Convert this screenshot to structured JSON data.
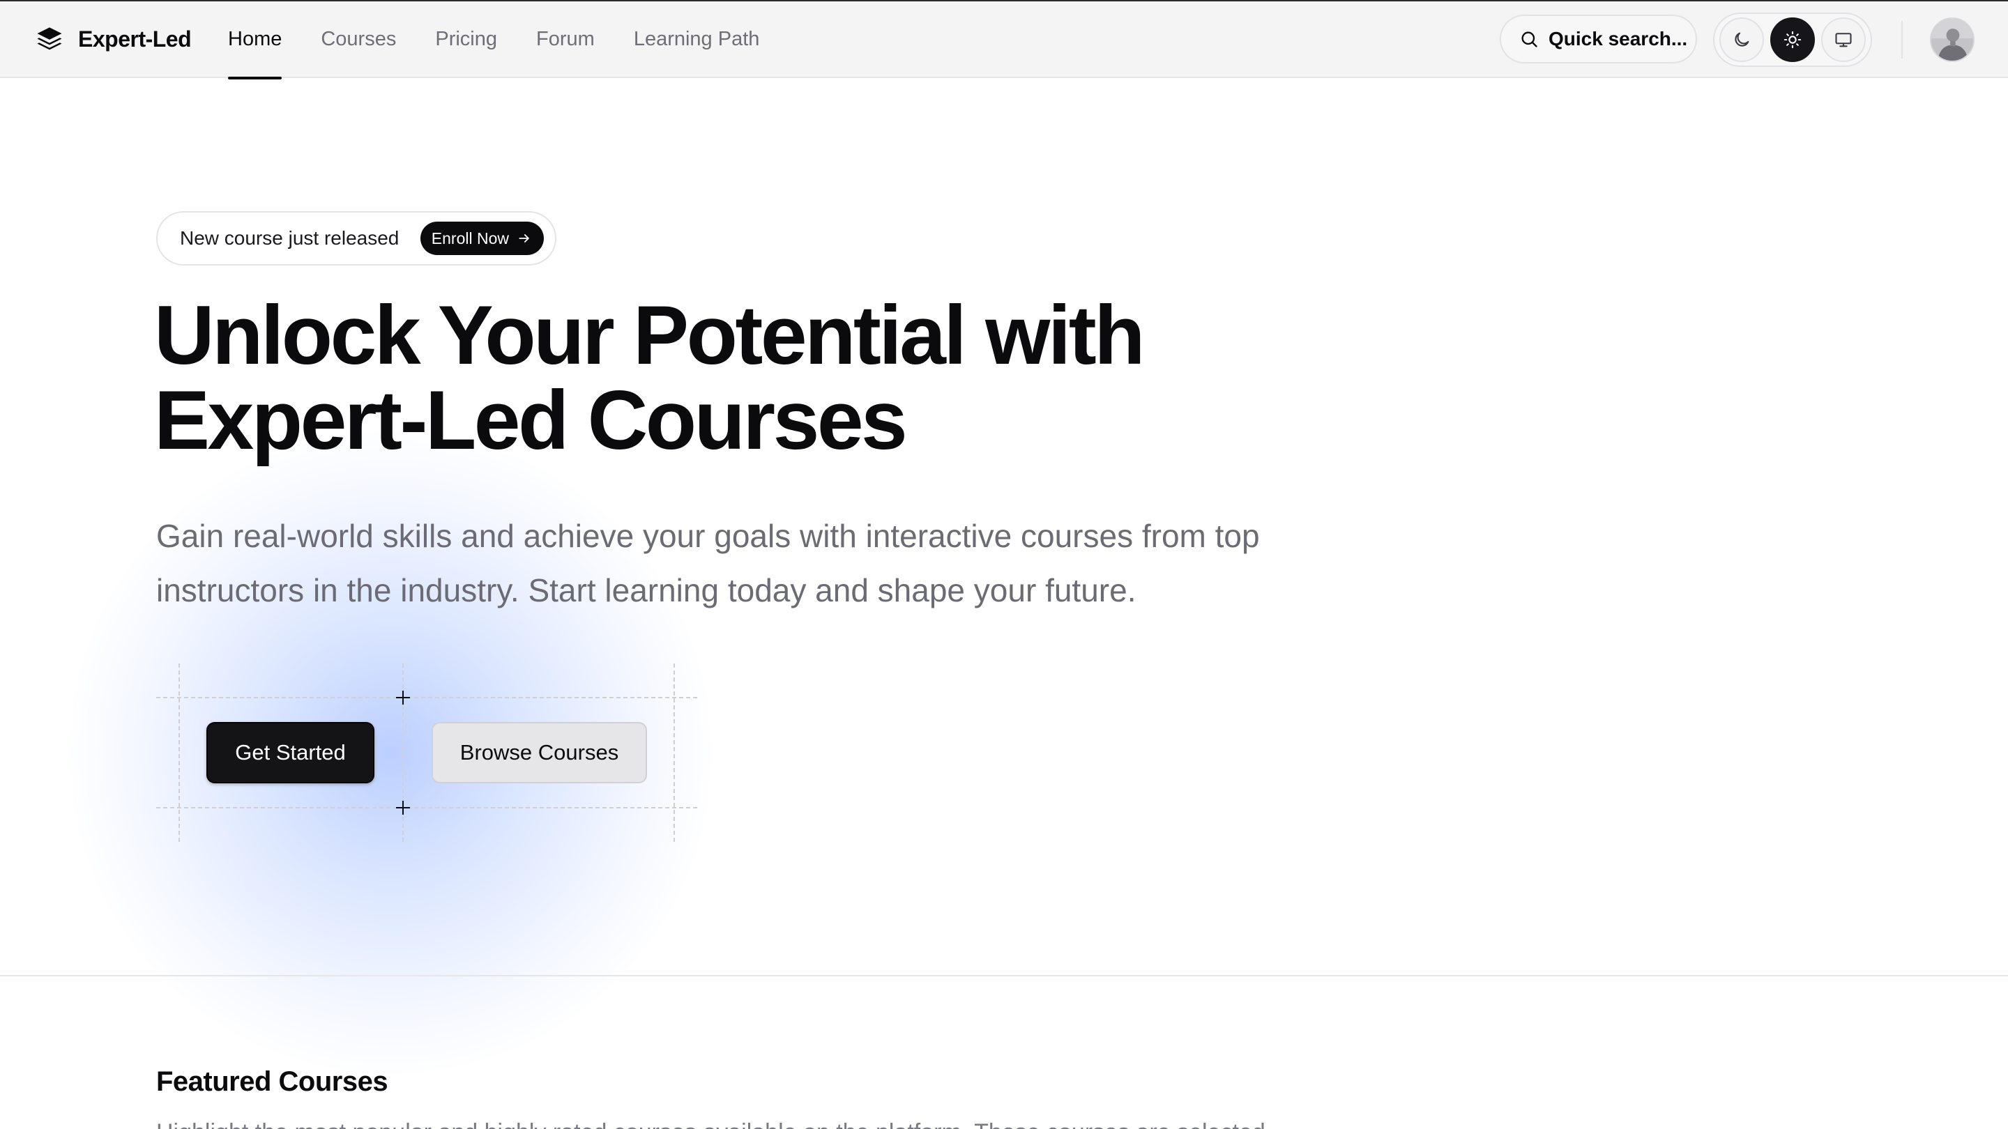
{
  "brand": {
    "name": "Expert-Led",
    "icon": "layers-icon"
  },
  "nav": {
    "items": [
      {
        "label": "Home",
        "active": true
      },
      {
        "label": "Courses",
        "active": false
      },
      {
        "label": "Pricing",
        "active": false
      },
      {
        "label": "Forum",
        "active": false
      },
      {
        "label": "Learning Path",
        "active": false
      }
    ]
  },
  "search": {
    "label": "Quick search...",
    "icon": "search-icon"
  },
  "theme": {
    "options": [
      {
        "icon": "moon-icon",
        "selected": false
      },
      {
        "icon": "sun-icon",
        "selected": true
      },
      {
        "icon": "monitor-icon",
        "selected": false
      }
    ]
  },
  "user": {
    "avatar": "user-avatar"
  },
  "hero": {
    "announcement": "New course just released",
    "announcement_cta": "Enroll Now",
    "title_line1": "Unlock Your Potential with",
    "title_line2": "Expert-Led Courses",
    "subtitle_line1": "Gain real-world skills and achieve your goals with interactive courses from top",
    "subtitle_line2": "instructors in the industry. Start learning today and shape your future.",
    "primary_cta": "Get Started",
    "secondary_cta": "Browse Courses"
  },
  "featured": {
    "title": "Featured Courses",
    "description": "Highlight the most popular and highly rated courses available on the platform. These courses are selected"
  },
  "colors": {
    "primary": "#0b0b0d",
    "muted_text": "#6b6b73",
    "header_bg": "#f4f4f5",
    "glow": "#7aa0ff"
  }
}
